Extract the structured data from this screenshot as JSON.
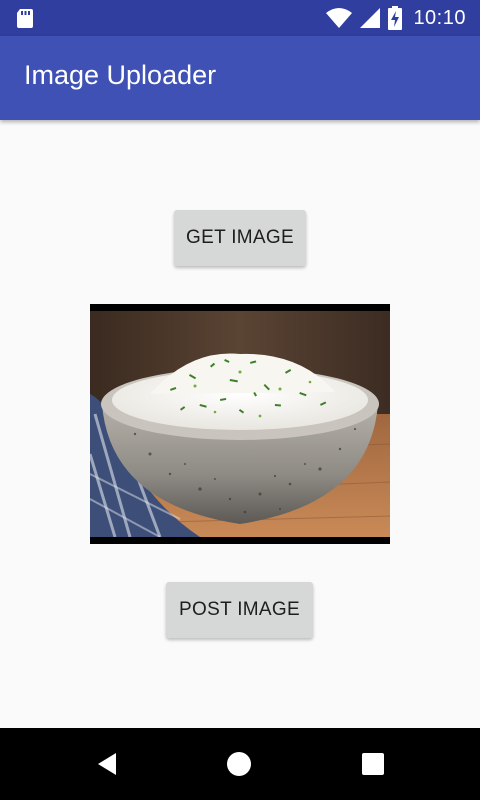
{
  "status_bar": {
    "time": "10:10",
    "icons": [
      "sd-card-icon",
      "wifi-icon",
      "signal-icon",
      "battery-charging-icon"
    ]
  },
  "app_bar": {
    "title": "Image Uploader",
    "color": "#3f51b5",
    "status_color": "#303f9f"
  },
  "main": {
    "get_image_label": "GET IMAGE",
    "post_image_label": "POST IMAGE",
    "image_subject": "bowl of white rice with chopped herbs"
  },
  "nav_bar": {
    "buttons": [
      "back-icon",
      "home-icon",
      "recents-icon"
    ]
  }
}
